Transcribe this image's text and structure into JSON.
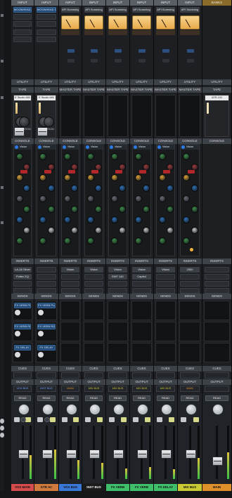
{
  "strips": [
    {
      "input": "INPUT",
      "source": "MOONHEAD 1+2",
      "utility": "UTILITY",
      "tape_hdr": "TAPE",
      "tape_title": "E Studio 680",
      "tape_left": "OUTPUT",
      "tape_right": "SATURATION",
      "console": "CONSOLE",
      "eq_name": "Vision",
      "inserts": "INSERTS",
      "insert_slots": [
        "LA-2A Silver",
        "Pultec EQ"
      ],
      "sends": "SENDS",
      "send_slots": [
        "FX VERB PLATE",
        "FX VERB ROOM",
        "FX DELAY"
      ],
      "cues": "CUES",
      "output": "OUTPUT",
      "output_value": "VOX BUS",
      "automation": "READ",
      "name": "Vox Main",
      "color": "#d64b4b"
    },
    {
      "input": "INPUT",
      "source": "MOONHEAD 1+2",
      "utility": "UTILITY",
      "tape_hdr": "TAPE",
      "tape_title": "E Studio 680",
      "tape_left": "OUTPUT",
      "tape_right": "SATURATION",
      "console": "CONSOLE",
      "eq_name": "Vision",
      "inserts": "INSERTS",
      "insert_slots": [],
      "sends": "SENDS",
      "send_slots": [
        "FX VERB PLATE",
        "FX VERB ROOM",
        "FX DELAY"
      ],
      "cues": "CUES",
      "output": "OUTPUT",
      "output_value": "INST BUS",
      "automation": "READ",
      "name": "Gtr Ac",
      "color": "#d07a3d"
    },
    {
      "input": "INPUT",
      "source": "API Summing",
      "utility": "UTILITY",
      "tape_hdr": "MASTER TAPE",
      "console": "CONSOLE",
      "eq_name": "Vision",
      "inserts": "INSERTS",
      "insert_slots": [
        "Vision"
      ],
      "sends": "SENDS",
      "send_slots": [],
      "cues": "CUES",
      "output": "OUTPUT",
      "output_value": "MAIN",
      "automation": "READ",
      "name": "VOX BUS",
      "color": "#3a78d8"
    },
    {
      "input": "INPUT",
      "source": "API Summing",
      "utility": "UTILITY",
      "tape_hdr": "MASTER TAPE",
      "console": "CONSOLE",
      "eq_name": "Vision",
      "inserts": "INSERTS",
      "insert_slots": [
        "Vision"
      ],
      "sends": "SENDS",
      "send_slots": [],
      "cues": "CUES",
      "output": "OUTPUT",
      "output_value": "MIX BUS",
      "automation": "READ",
      "name": "INST BUS",
      "color": "#1b1b1b"
    },
    {
      "input": "INPUT",
      "source": "API Summing",
      "utility": "UTILITY",
      "tape_hdr": "MASTER TAPE",
      "console": "CONSOLE",
      "eq_name": "Vision",
      "inserts": "INSERTS",
      "insert_slots": [
        "Vision",
        "EMT 140"
      ],
      "sends": "SENDS",
      "send_slots": [],
      "cues": "CUES",
      "output": "OUTPUT",
      "output_value": "MIX BUS",
      "automation": "READ",
      "name": "FX VERB PLATE",
      "color": "#3fbf6a"
    },
    {
      "input": "INPUT",
      "source": "API Summing",
      "utility": "UTILITY",
      "tape_hdr": "MASTER TAPE",
      "console": "CONSOLE",
      "eq_name": "Vision",
      "inserts": "INSERTS",
      "insert_slots": [
        "Vision",
        "Capitol"
      ],
      "sends": "SENDS",
      "send_slots": [],
      "cues": "CUES",
      "output": "OUTPUT",
      "output_value": "MIX BUS",
      "automation": "READ",
      "name": "FX VERB ROOM",
      "color": "#3fbf6a"
    },
    {
      "input": "INPUT",
      "source": "API Summing",
      "utility": "UTILITY",
      "tape_hdr": "MASTER TAPE",
      "console": "CONSOLE",
      "eq_name": "Vision",
      "inserts": "INSERTS",
      "insert_slots": [
        "Vision"
      ],
      "sends": "SENDS",
      "send_slots": [],
      "cues": "CUES",
      "output": "OUTPUT",
      "output_value": "MIX BUS",
      "automation": "READ",
      "name": "FX DELAY",
      "color": "#3fbf6a"
    },
    {
      "input": "INPUT",
      "source": "API Summing",
      "utility": "UTILITY",
      "tape_hdr": "MASTER TAPE",
      "console": "CONSOLE",
      "eq_name": "Vision",
      "inserts": "INSERTS",
      "insert_slots": [
        "2500"
      ],
      "sends": "SENDS",
      "send_slots": [],
      "cues": "CUES",
      "output": "OUTPUT",
      "output_value": "MAIN",
      "automation": "READ",
      "name": "MIX BUS",
      "color": "#c9c933"
    },
    {
      "input": "BANKS",
      "source": "",
      "utility": "UTILITY",
      "tape_hdr": "TAPE",
      "tape_title": "ATR-102",
      "console": "CONSOLE",
      "eq_name": "",
      "inserts": "INSERTS",
      "insert_slots": [],
      "sends": "SENDS",
      "send_slots": [],
      "cues": "CUES",
      "output": "OUTPUT",
      "output_value": "",
      "automation": "READ",
      "name": "MAIN",
      "color": "#e0902a"
    }
  ],
  "meters": [
    0.45,
    0.55,
    0.35,
    0.3,
    0.2,
    0.22,
    0.18,
    0.4,
    0.5
  ]
}
